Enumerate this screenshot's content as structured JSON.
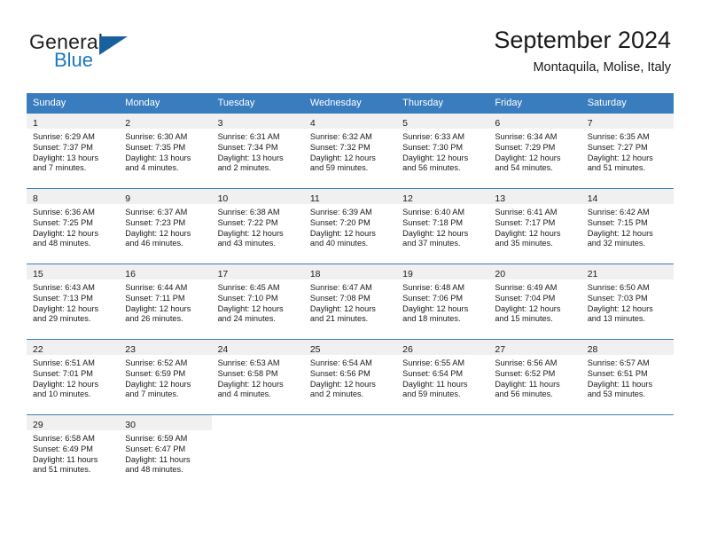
{
  "brand": {
    "name_part1": "General",
    "name_part2": "Blue",
    "flag_icon": "blue-flag-icon",
    "accent_color": "#1b78c2"
  },
  "header": {
    "title": "September 2024",
    "subtitle": "Montaquila, Molise, Italy"
  },
  "theme": {
    "header_row_bg": "#3a7dbf",
    "daynum_band_bg": "#f0f0f0",
    "grid_line": "#3a7dbf",
    "text": "#1a1a1a"
  },
  "weekdays": [
    "Sunday",
    "Monday",
    "Tuesday",
    "Wednesday",
    "Thursday",
    "Friday",
    "Saturday"
  ],
  "weeks": [
    [
      {
        "day": "1",
        "sunrise": "Sunrise: 6:29 AM",
        "sunset": "Sunset: 7:37 PM",
        "daylight1": "Daylight: 13 hours",
        "daylight2": "and 7 minutes."
      },
      {
        "day": "2",
        "sunrise": "Sunrise: 6:30 AM",
        "sunset": "Sunset: 7:35 PM",
        "daylight1": "Daylight: 13 hours",
        "daylight2": "and 4 minutes."
      },
      {
        "day": "3",
        "sunrise": "Sunrise: 6:31 AM",
        "sunset": "Sunset: 7:34 PM",
        "daylight1": "Daylight: 13 hours",
        "daylight2": "and 2 minutes."
      },
      {
        "day": "4",
        "sunrise": "Sunrise: 6:32 AM",
        "sunset": "Sunset: 7:32 PM",
        "daylight1": "Daylight: 12 hours",
        "daylight2": "and 59 minutes."
      },
      {
        "day": "5",
        "sunrise": "Sunrise: 6:33 AM",
        "sunset": "Sunset: 7:30 PM",
        "daylight1": "Daylight: 12 hours",
        "daylight2": "and 56 minutes."
      },
      {
        "day": "6",
        "sunrise": "Sunrise: 6:34 AM",
        "sunset": "Sunset: 7:29 PM",
        "daylight1": "Daylight: 12 hours",
        "daylight2": "and 54 minutes."
      },
      {
        "day": "7",
        "sunrise": "Sunrise: 6:35 AM",
        "sunset": "Sunset: 7:27 PM",
        "daylight1": "Daylight: 12 hours",
        "daylight2": "and 51 minutes."
      }
    ],
    [
      {
        "day": "8",
        "sunrise": "Sunrise: 6:36 AM",
        "sunset": "Sunset: 7:25 PM",
        "daylight1": "Daylight: 12 hours",
        "daylight2": "and 48 minutes."
      },
      {
        "day": "9",
        "sunrise": "Sunrise: 6:37 AM",
        "sunset": "Sunset: 7:23 PM",
        "daylight1": "Daylight: 12 hours",
        "daylight2": "and 46 minutes."
      },
      {
        "day": "10",
        "sunrise": "Sunrise: 6:38 AM",
        "sunset": "Sunset: 7:22 PM",
        "daylight1": "Daylight: 12 hours",
        "daylight2": "and 43 minutes."
      },
      {
        "day": "11",
        "sunrise": "Sunrise: 6:39 AM",
        "sunset": "Sunset: 7:20 PM",
        "daylight1": "Daylight: 12 hours",
        "daylight2": "and 40 minutes."
      },
      {
        "day": "12",
        "sunrise": "Sunrise: 6:40 AM",
        "sunset": "Sunset: 7:18 PM",
        "daylight1": "Daylight: 12 hours",
        "daylight2": "and 37 minutes."
      },
      {
        "day": "13",
        "sunrise": "Sunrise: 6:41 AM",
        "sunset": "Sunset: 7:17 PM",
        "daylight1": "Daylight: 12 hours",
        "daylight2": "and 35 minutes."
      },
      {
        "day": "14",
        "sunrise": "Sunrise: 6:42 AM",
        "sunset": "Sunset: 7:15 PM",
        "daylight1": "Daylight: 12 hours",
        "daylight2": "and 32 minutes."
      }
    ],
    [
      {
        "day": "15",
        "sunrise": "Sunrise: 6:43 AM",
        "sunset": "Sunset: 7:13 PM",
        "daylight1": "Daylight: 12 hours",
        "daylight2": "and 29 minutes."
      },
      {
        "day": "16",
        "sunrise": "Sunrise: 6:44 AM",
        "sunset": "Sunset: 7:11 PM",
        "daylight1": "Daylight: 12 hours",
        "daylight2": "and 26 minutes."
      },
      {
        "day": "17",
        "sunrise": "Sunrise: 6:45 AM",
        "sunset": "Sunset: 7:10 PM",
        "daylight1": "Daylight: 12 hours",
        "daylight2": "and 24 minutes."
      },
      {
        "day": "18",
        "sunrise": "Sunrise: 6:47 AM",
        "sunset": "Sunset: 7:08 PM",
        "daylight1": "Daylight: 12 hours",
        "daylight2": "and 21 minutes."
      },
      {
        "day": "19",
        "sunrise": "Sunrise: 6:48 AM",
        "sunset": "Sunset: 7:06 PM",
        "daylight1": "Daylight: 12 hours",
        "daylight2": "and 18 minutes."
      },
      {
        "day": "20",
        "sunrise": "Sunrise: 6:49 AM",
        "sunset": "Sunset: 7:04 PM",
        "daylight1": "Daylight: 12 hours",
        "daylight2": "and 15 minutes."
      },
      {
        "day": "21",
        "sunrise": "Sunrise: 6:50 AM",
        "sunset": "Sunset: 7:03 PM",
        "daylight1": "Daylight: 12 hours",
        "daylight2": "and 13 minutes."
      }
    ],
    [
      {
        "day": "22",
        "sunrise": "Sunrise: 6:51 AM",
        "sunset": "Sunset: 7:01 PM",
        "daylight1": "Daylight: 12 hours",
        "daylight2": "and 10 minutes."
      },
      {
        "day": "23",
        "sunrise": "Sunrise: 6:52 AM",
        "sunset": "Sunset: 6:59 PM",
        "daylight1": "Daylight: 12 hours",
        "daylight2": "and 7 minutes."
      },
      {
        "day": "24",
        "sunrise": "Sunrise: 6:53 AM",
        "sunset": "Sunset: 6:58 PM",
        "daylight1": "Daylight: 12 hours",
        "daylight2": "and 4 minutes."
      },
      {
        "day": "25",
        "sunrise": "Sunrise: 6:54 AM",
        "sunset": "Sunset: 6:56 PM",
        "daylight1": "Daylight: 12 hours",
        "daylight2": "and 2 minutes."
      },
      {
        "day": "26",
        "sunrise": "Sunrise: 6:55 AM",
        "sunset": "Sunset: 6:54 PM",
        "daylight1": "Daylight: 11 hours",
        "daylight2": "and 59 minutes."
      },
      {
        "day": "27",
        "sunrise": "Sunrise: 6:56 AM",
        "sunset": "Sunset: 6:52 PM",
        "daylight1": "Daylight: 11 hours",
        "daylight2": "and 56 minutes."
      },
      {
        "day": "28",
        "sunrise": "Sunrise: 6:57 AM",
        "sunset": "Sunset: 6:51 PM",
        "daylight1": "Daylight: 11 hours",
        "daylight2": "and 53 minutes."
      }
    ],
    [
      {
        "day": "29",
        "sunrise": "Sunrise: 6:58 AM",
        "sunset": "Sunset: 6:49 PM",
        "daylight1": "Daylight: 11 hours",
        "daylight2": "and 51 minutes."
      },
      {
        "day": "30",
        "sunrise": "Sunrise: 6:59 AM",
        "sunset": "Sunset: 6:47 PM",
        "daylight1": "Daylight: 11 hours",
        "daylight2": "and 48 minutes."
      },
      {
        "day": "",
        "sunrise": "",
        "sunset": "",
        "daylight1": "",
        "daylight2": ""
      },
      {
        "day": "",
        "sunrise": "",
        "sunset": "",
        "daylight1": "",
        "daylight2": ""
      },
      {
        "day": "",
        "sunrise": "",
        "sunset": "",
        "daylight1": "",
        "daylight2": ""
      },
      {
        "day": "",
        "sunrise": "",
        "sunset": "",
        "daylight1": "",
        "daylight2": ""
      },
      {
        "day": "",
        "sunrise": "",
        "sunset": "",
        "daylight1": "",
        "daylight2": ""
      }
    ]
  ]
}
